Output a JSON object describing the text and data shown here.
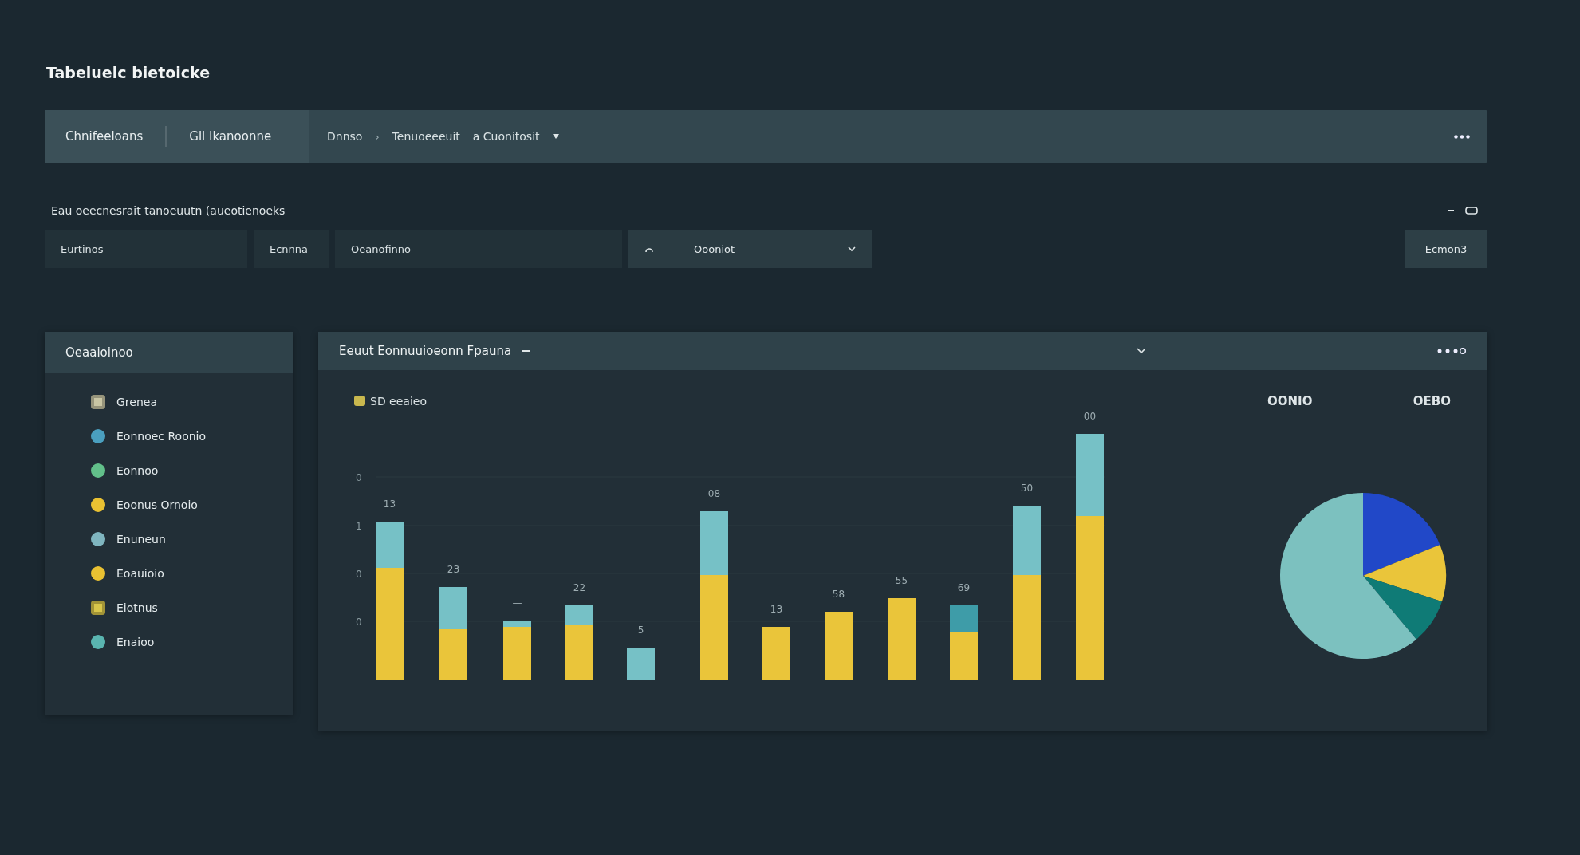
{
  "title": "Tabeluelc bietoicke",
  "toolbar": {
    "left_items": [
      "Chnifeeloans",
      "Gll Ikanoonne"
    ],
    "breadcrumb": [
      "Dnnso",
      "Tenuoeeeuit",
      "a Cuonitosit"
    ],
    "separator": "›"
  },
  "section": {
    "heading": "Eau oeecnesrait tanoeuutn (aueotienoeks"
  },
  "filters": {
    "cells": [
      "Eurtinos",
      "Ecnnna",
      "Oeanofinno"
    ],
    "dropdown": {
      "value": "Oooniot"
    },
    "button": "Ecmon3"
  },
  "legend_panel": {
    "title": "Oeaaioinoo",
    "items": [
      {
        "label": "Grenea",
        "kind": "square",
        "color": "#c9c6a4"
      },
      {
        "label": "Eonnoec Roonio",
        "kind": "dot",
        "color": "#4a9fbf"
      },
      {
        "label": "Eonnoo",
        "kind": "dot",
        "color": "#62c08a"
      },
      {
        "label": "Eoonus Ornoio",
        "kind": "dot",
        "color": "#e9c132"
      },
      {
        "label": "Enuneun",
        "kind": "dot",
        "color": "#7fb5bf"
      },
      {
        "label": "Eoauioio",
        "kind": "dot",
        "color": "#e9c132"
      },
      {
        "label": "Eiotnus",
        "kind": "square",
        "color": "#d8c64a"
      },
      {
        "label": "Enaioo",
        "kind": "dot",
        "color": "#5ab5b0"
      }
    ]
  },
  "chart_panel": {
    "title": "Eeuut Eonnuuioeonn Fpauna",
    "legend": "SD eeaieo",
    "y_labels": [
      "0",
      "1",
      "0",
      "0"
    ],
    "bar_labels": [
      "13",
      "23",
      "—",
      "22",
      "5",
      "08",
      "13",
      "58",
      "55",
      "69",
      "50",
      "00"
    ],
    "pie_labels": [
      "OONIO",
      "OEBO"
    ]
  }
}
